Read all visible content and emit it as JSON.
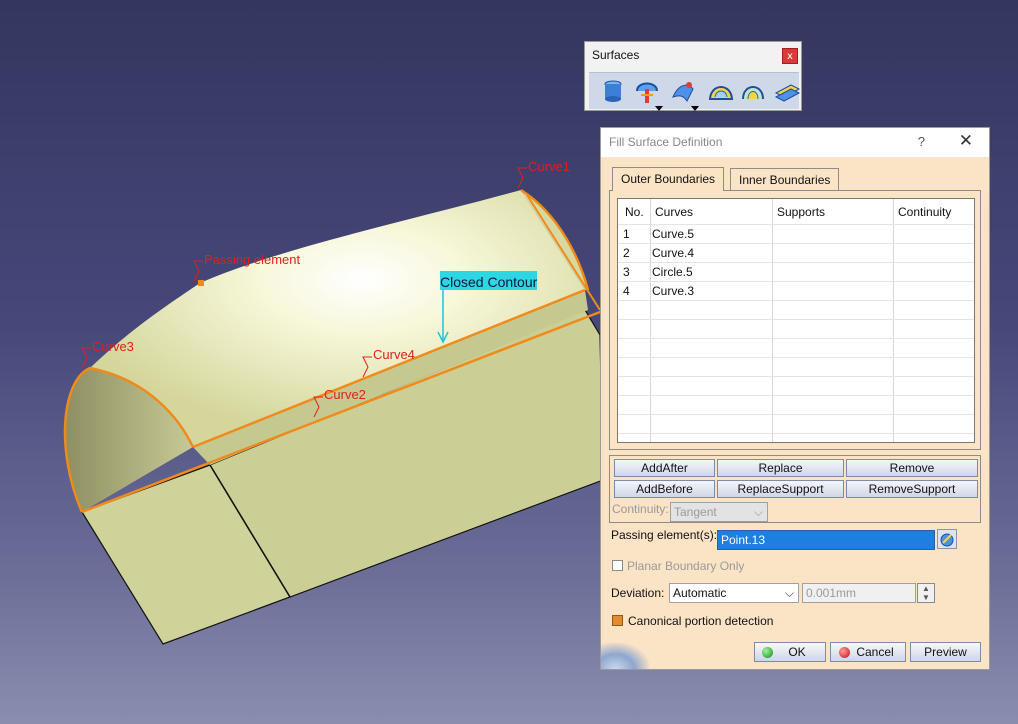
{
  "viewport": {
    "labels": {
      "curve1": "Curve1",
      "curve2": "Curve2",
      "curve3": "Curve3",
      "curve4": "Curve4",
      "passing_element": "Passing element",
      "closed_contour": "Closed Contour"
    }
  },
  "toolbar": {
    "title": "Surfaces",
    "close": "x",
    "tools": [
      "extrude-icon",
      "revolve-icon",
      "sweep-icon",
      "fill-icon",
      "blend-icon",
      "offset-icon"
    ]
  },
  "dialog": {
    "title": "Fill Surface Definition",
    "help": "?",
    "close": "✕",
    "tabs": [
      "Outer Boundaries",
      "Inner Boundaries"
    ],
    "columns": [
      "No.",
      "Curves",
      "Supports",
      "Continuity"
    ],
    "rows": [
      {
        "no": "1",
        "curve": "Curve.5",
        "support": "",
        "continuity": ""
      },
      {
        "no": "2",
        "curve": "Curve.4",
        "support": "",
        "continuity": ""
      },
      {
        "no": "3",
        "curve": "Circle.5",
        "support": "",
        "continuity": ""
      },
      {
        "no": "4",
        "curve": "Curve.3",
        "support": "",
        "continuity": ""
      }
    ],
    "buttons": {
      "add_after": "AddAfter",
      "replace": "Replace",
      "remove": "Remove",
      "add_before": "AddBefore",
      "replace_support": "ReplaceSupport",
      "remove_support": "RemoveSupport"
    },
    "continuity_label": "Continuity:",
    "continuity_value": "Tangent",
    "passing_label": "Passing element(s):",
    "passing_value": "Point.13",
    "planar_label": "Planar Boundary Only",
    "deviation_label": "Deviation:",
    "deviation_mode": "Automatic",
    "deviation_value": "0.001mm",
    "canonical_label": "Canonical portion detection",
    "canonical_checked": true,
    "ok": "OK",
    "cancel": "Cancel",
    "preview": "Preview"
  }
}
